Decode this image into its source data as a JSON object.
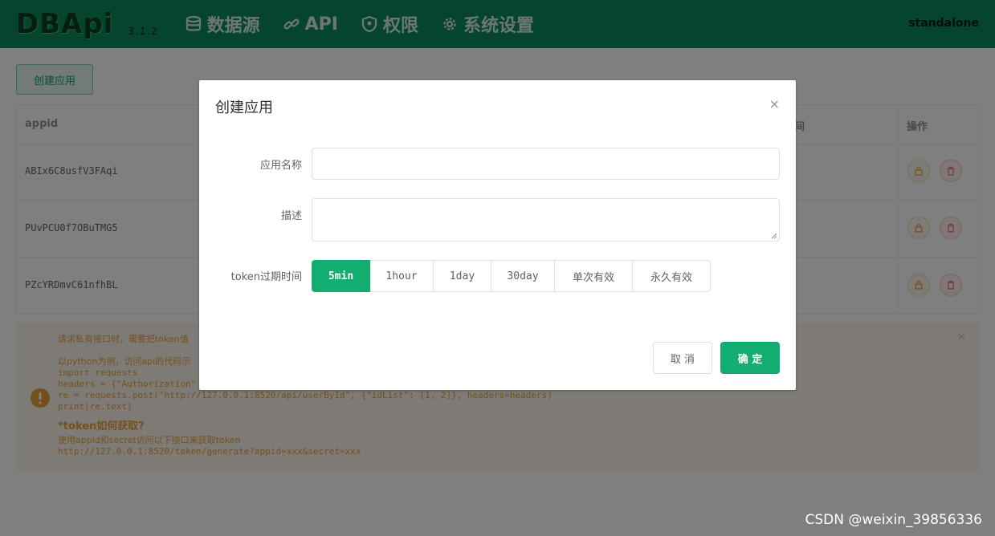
{
  "header": {
    "logo": "DBApi",
    "version": "3.1.2",
    "nav": [
      {
        "label": "数据源",
        "icon": "database-icon"
      },
      {
        "label": "API",
        "icon": "link-icon"
      },
      {
        "label": "权限",
        "icon": "shield-icon"
      },
      {
        "label": "系统设置",
        "icon": "gear-icon"
      }
    ],
    "user": "standalone"
  },
  "page": {
    "create_button": "创建应用",
    "table": {
      "columns": {
        "appid": "appid",
        "time_partial": "间",
        "actions": "操作"
      },
      "rows": [
        {
          "appid": "ABIx6C8usfV3FAqi"
        },
        {
          "appid": "PUvPCU0f7OBuTMG5"
        },
        {
          "appid": "PZcYRDmvC61nfhBL"
        }
      ],
      "row_actions": {
        "lock_icon": "lock-icon",
        "delete_icon": "trash-icon"
      }
    },
    "alert": {
      "icon": "warning-icon",
      "line1": "请求私有接口时，需要把token值",
      "line2": "以python为例，访问api的代码示",
      "code": [
        "import requests",
        "headers = {\"Authorization\"",
        "re = requests.post(\"http://127.0.0.1:8520/api/userById\", {\"idList\": [1, 2]}, headers=headers)",
        "print(re.text)"
      ],
      "subhead": "*token如何获取?",
      "line3": "使用appid和secret访问以下接口来获取token",
      "url": "http://127.0.0.1:8520/token/generate?appid=xxx&secret=xxx"
    }
  },
  "dialog": {
    "title": "创建应用",
    "close": "×",
    "fields": {
      "name_label": "应用名称",
      "name_value": "",
      "desc_label": "描述",
      "desc_value": "",
      "token_label": "token过期时间"
    },
    "token_options": [
      "5min",
      "1hour",
      "1day",
      "30day",
      "单次有效",
      "永久有效"
    ],
    "token_selected": "5min",
    "cancel": "取 消",
    "ok": "确 定"
  },
  "watermark": "CSDN @weixin_39856336",
  "colors": {
    "header_bg": "#0a8a5a",
    "primary": "#13ad6f",
    "warning": "#e6a23c",
    "danger": "#f56c6c"
  }
}
